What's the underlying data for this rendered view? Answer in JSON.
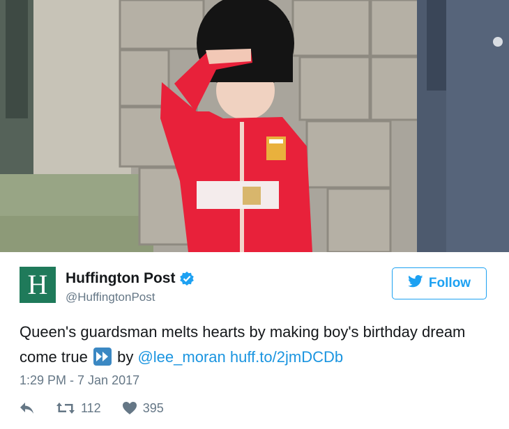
{
  "media": {
    "description_icon": "video-thumbnail"
  },
  "author": {
    "avatar_letter": "H",
    "name": "Huffington Post",
    "handle": "@HuffingtonPost",
    "verified_icon": "verified-badge-icon",
    "avatar_color": "#1f7a5a"
  },
  "follow_button": {
    "label": "Follow",
    "icon": "twitter-bird-icon",
    "color": "#1da1f2"
  },
  "tweet": {
    "text_part1": "Queen's guardsman melts hearts by making boy's birthday dream come true",
    "emoji": "fast-forward-emoji",
    "by": "by",
    "mention": "@lee_moran",
    "url": "huff.to/2jmDCDb",
    "timestamp": "1:29 PM - 7 Jan 2017",
    "link_color": "#1b95e0"
  },
  "actions": {
    "reply_icon": "reply-icon",
    "retweet_icon": "retweet-icon",
    "retweet_count": "112",
    "like_icon": "heart-icon",
    "like_count": "395"
  }
}
